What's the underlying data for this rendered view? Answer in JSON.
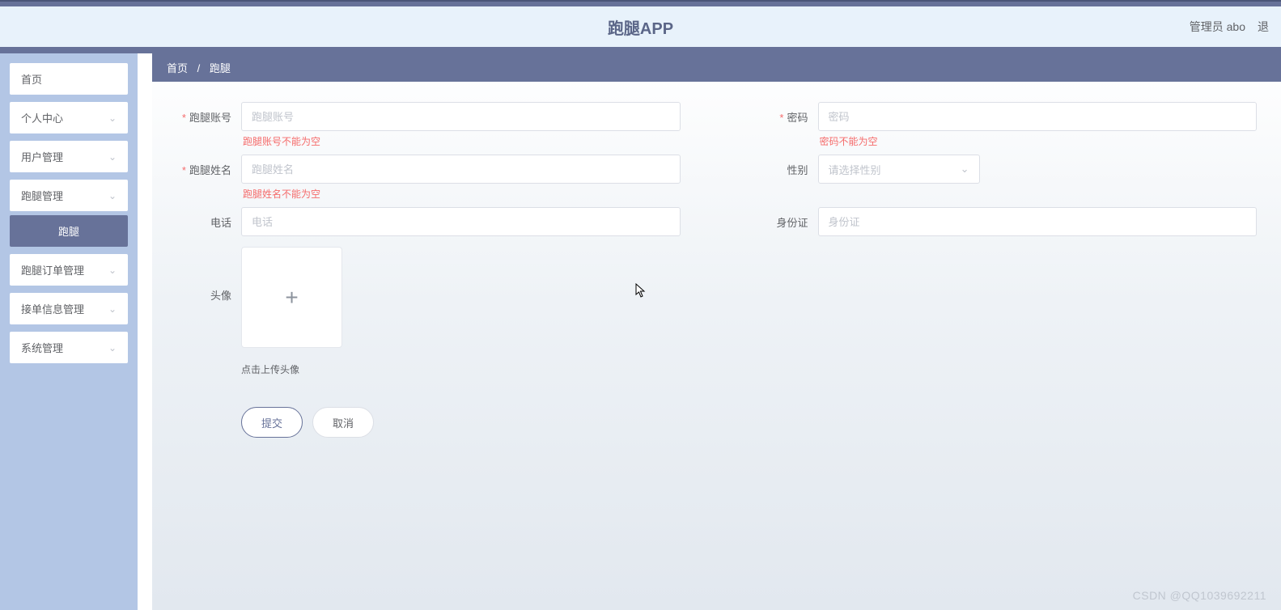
{
  "header": {
    "title": "跑腿APP",
    "user_label": "管理员 abo",
    "logout_label": "退"
  },
  "sidebar": {
    "items": [
      {
        "label": "首页",
        "expandable": false
      },
      {
        "label": "个人中心",
        "expandable": true
      },
      {
        "label": "用户管理",
        "expandable": true
      },
      {
        "label": "跑腿管理",
        "expandable": true
      },
      {
        "label": "跑腿订单管理",
        "expandable": true
      },
      {
        "label": "接单信息管理",
        "expandable": true
      },
      {
        "label": "系统管理",
        "expandable": true
      }
    ],
    "active_sub": "跑腿"
  },
  "breadcrumb": {
    "home": "首页",
    "sep": "/",
    "current": "跑腿"
  },
  "form": {
    "account": {
      "label": "跑腿账号",
      "placeholder": "跑腿账号",
      "error": "跑腿账号不能为空"
    },
    "password": {
      "label": "密码",
      "placeholder": "密码",
      "error": "密码不能为空"
    },
    "name": {
      "label": "跑腿姓名",
      "placeholder": "跑腿姓名",
      "error": "跑腿姓名不能为空"
    },
    "gender": {
      "label": "性别",
      "placeholder": "请选择性别"
    },
    "phone": {
      "label": "电话",
      "placeholder": "电话"
    },
    "idcard": {
      "label": "身份证",
      "placeholder": "身份证"
    },
    "avatar": {
      "label": "头像",
      "hint": "点击上传头像"
    },
    "buttons": {
      "submit": "提交",
      "cancel": "取消"
    }
  },
  "watermark": "CSDN @QQ1039692211"
}
